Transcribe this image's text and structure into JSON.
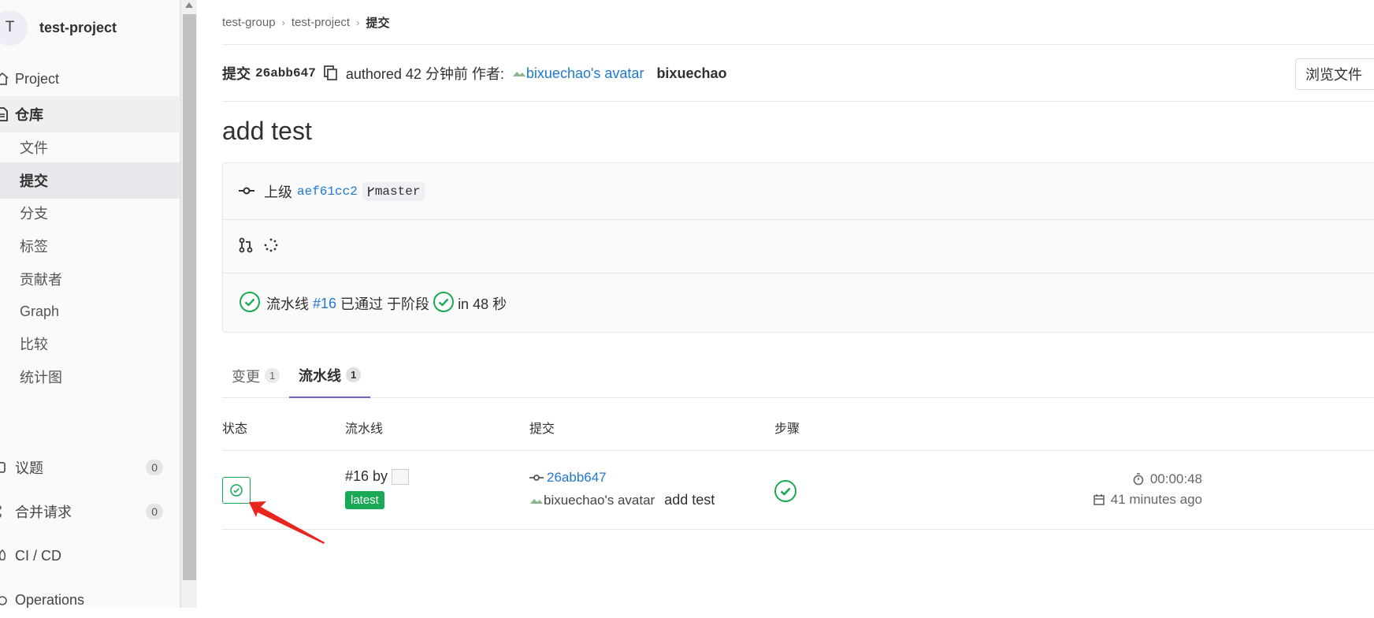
{
  "sidebar": {
    "avatar_letter": "T",
    "project_name": "test-project",
    "items": [
      {
        "label": "Project",
        "icon": "home-icon"
      },
      {
        "label": "仓库",
        "icon": "document-icon"
      }
    ],
    "repo_sub": [
      "文件",
      "提交",
      "分支",
      "标签",
      "贡献者",
      "Graph",
      "比较",
      "统计图"
    ],
    "lower_items": [
      {
        "label": "议题",
        "icon": "issues-icon",
        "count": "0"
      },
      {
        "label": "合并请求",
        "icon": "merge-request-icon",
        "count": "0"
      },
      {
        "label": "CI / CD",
        "icon": "rocket-icon"
      },
      {
        "label": "Operations",
        "icon": "cloud-gear-icon"
      }
    ]
  },
  "breadcrumb": [
    "test-group",
    "test-project",
    "提交"
  ],
  "commit": {
    "label": "提交",
    "sha": "26abb647",
    "authored": "authored 42 分钟前 作者:",
    "avatar_alt": "bixuechao's avatar",
    "author": "bixuechao",
    "title": "add test",
    "browse_files": "浏览文件",
    "parent_label": "上级",
    "parent_sha": "aef61cc2",
    "branch": "master",
    "pipeline_prefix": "流水线",
    "pipeline_link": "#16",
    "pipeline_status": "已通过 于阶段",
    "pipeline_time": "in 48 秒"
  },
  "tabs": [
    {
      "label": "变更",
      "count": "1"
    },
    {
      "label": "流水线",
      "count": "1"
    }
  ],
  "table": {
    "headers": [
      "状态",
      "流水线",
      "提交",
      "步骤"
    ],
    "row": {
      "pipeline_id": "#16 by",
      "latest": "latest",
      "commit_sha": "26abb647",
      "avatar_alt": "bixuechao's avatar",
      "commit_msg": "add test",
      "duration": "00:00:48",
      "finished": "41 minutes ago"
    }
  },
  "colors": {
    "success": "#1aaa55",
    "link": "#1f78d1",
    "tab_active": "#6666c4",
    "arrow": "#e8261f"
  }
}
